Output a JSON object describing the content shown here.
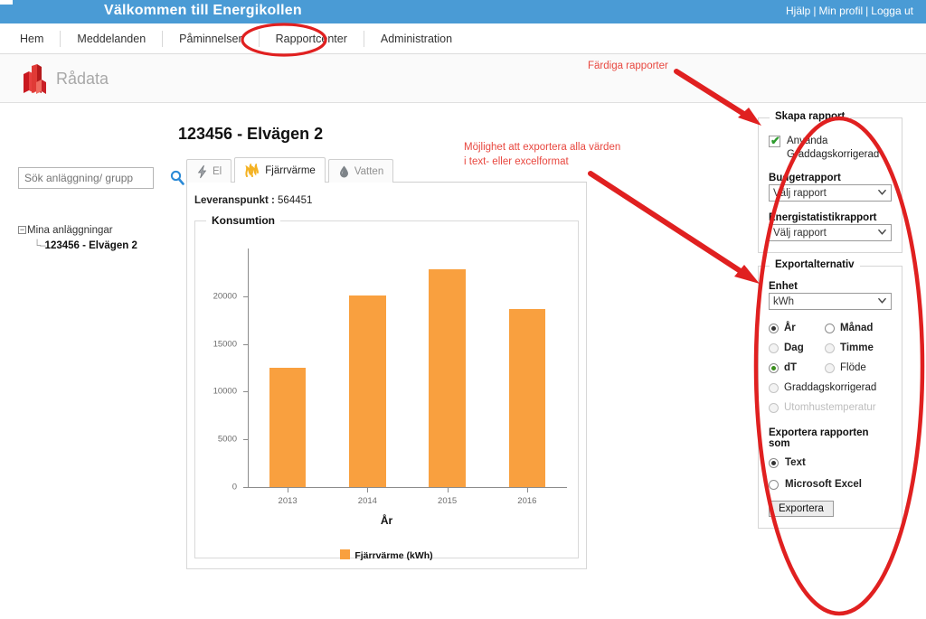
{
  "header": {
    "welcome": "Välkommen till Energikollen",
    "links": [
      "Hjälp",
      "Min profil",
      "Logga ut"
    ],
    "separator": "|",
    "blue": "#4a9bd5"
  },
  "nav": {
    "items": [
      {
        "label": "Hem"
      },
      {
        "label": "Meddelanden"
      },
      {
        "label": "Påminnelser"
      },
      {
        "label": "Rapportcenter"
      },
      {
        "label": "Administration"
      }
    ],
    "circled": "Rapportcenter"
  },
  "page": {
    "title": "Rådata",
    "logo_icon": "bar-chart-icon"
  },
  "sidebar": {
    "search": {
      "placeholder": "Sök anläggning/ grupp",
      "value": "",
      "icon": "search-icon"
    },
    "tree": {
      "expander": "−",
      "root": "Mina anläggningar",
      "child": "123456 - Elvägen 2"
    }
  },
  "main": {
    "asset_title": "123456 - Elvägen 2",
    "tabs": [
      {
        "label": "El",
        "icon": "lightning-icon",
        "active": false
      },
      {
        "label": "Fjärrvärme",
        "icon": "flame-icon",
        "active": true
      },
      {
        "label": "Vatten",
        "icon": "water-drop-icon",
        "active": false
      }
    ],
    "delivery_point_label": "Leveranspunkt :",
    "delivery_point_value": "564451",
    "fieldset_legend": "Konsumtion"
  },
  "chart_data": {
    "type": "bar",
    "title": "",
    "categories": [
      "2013",
      "2014",
      "2015",
      "2016"
    ],
    "values": [
      12500,
      20100,
      22800,
      18700
    ],
    "series": [
      {
        "name": "Fjärrvärme (kWh)",
        "values": [
          12500,
          20100,
          22800,
          18700
        ],
        "color": "#f9a03f"
      }
    ],
    "xlabel": "År",
    "ylabel": "",
    "ylim": [
      0,
      25000
    ],
    "yticks": [
      0,
      5000,
      10000,
      15000,
      20000
    ],
    "ytick_labels": [
      "0",
      "5000",
      "10000",
      "15000",
      "20000"
    ],
    "grid": false,
    "legend": "Fjärrvärme (kWh)",
    "legend_position": "bottom"
  },
  "report_panel": {
    "legend": "Skapa rapport",
    "checkbox": {
      "checked": true,
      "check_glyph": "✔",
      "label_line1": "Använda",
      "label_line2": "Graddagskorrigerad"
    },
    "budget_label": "Budgetrapport",
    "budget_value": "Välj rapport",
    "energy_label": "Energistatistikrapport",
    "energy_value": "Välj rapport"
  },
  "export_panel": {
    "legend": "Exportalternativ",
    "unit_label": "Enhet",
    "unit_value": "kWh",
    "resolution_options": [
      {
        "label": "År",
        "selected": true,
        "disabled": false
      },
      {
        "label": "Månad",
        "selected": false,
        "disabled": false
      },
      {
        "label": "Dag",
        "selected": false,
        "disabled": true
      },
      {
        "label": "Timme",
        "selected": false,
        "disabled": true
      }
    ],
    "value_options": [
      {
        "label": "dT",
        "selected": true,
        "disabled": false,
        "dot": "green"
      },
      {
        "label": "Flöde",
        "selected": false,
        "disabled": true
      },
      {
        "label": "Graddagskorrigerad",
        "selected": false,
        "disabled": true
      },
      {
        "label": "Utomhustemperatur",
        "selected": false,
        "disabled": true
      }
    ],
    "format_label": "Exportera rapporten som",
    "format_options": [
      {
        "label": "Text",
        "selected": true
      },
      {
        "label": "Microsoft Excel",
        "selected": false
      }
    ],
    "button": "Exportera"
  },
  "annotations": {
    "color": "#e8473f",
    "note_top": "Färdiga rapporter",
    "note_left_line1": "Möjlighet att exportera alla värden",
    "note_left_line2": "i text- eller excelformat"
  }
}
